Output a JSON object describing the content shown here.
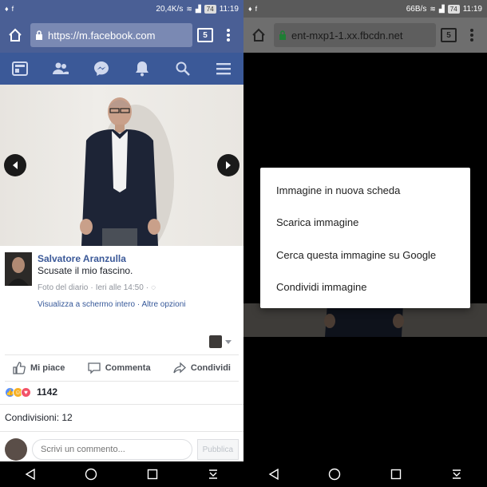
{
  "left": {
    "status": {
      "speed": "20,4K/s",
      "battery": "74",
      "time": "11:19"
    },
    "browser": {
      "url": "https://m.facebook.com",
      "tab_count": "5"
    },
    "post": {
      "author": "Salvatore Aranzulla",
      "caption": "Scusate il mio fascino.",
      "album": "Foto del diario",
      "separator": "·",
      "time": "Ieri alle 14:50",
      "view_fullscreen": "Visualizza a schermo intero",
      "more_options": "Altre opzioni",
      "actions": {
        "like": "Mi piace",
        "comment": "Commenta",
        "share": "Condividi"
      },
      "reaction_count": "1142",
      "shares": "Condivisioni: 12",
      "comment_placeholder": "Scrivi un commento...",
      "publish": "Pubblica"
    }
  },
  "right": {
    "status": {
      "speed": "66B/s",
      "battery": "74",
      "time": "11:19"
    },
    "browser": {
      "url": "ent-mxp1-1.xx.fbcdn.net",
      "tab_count": "5"
    },
    "context_menu": [
      "Immagine in nuova scheda",
      "Scarica immagine",
      "Cerca questa immagine su Google",
      "Condividi immagine"
    ]
  },
  "colors": {
    "facebook_blue": "#3b5998",
    "browser_bar": "#4a5f95",
    "link_blue": "#365899"
  },
  "icons": [
    "home-icon",
    "lock-icon",
    "tabs-icon",
    "overflow-menu-icon",
    "news-feed-icon",
    "friends-icon",
    "messenger-icon",
    "notifications-icon",
    "search-icon",
    "hamburger-menu-icon",
    "chevron-left-icon",
    "chevron-right-icon",
    "like-icon",
    "comment-icon",
    "share-icon",
    "back-icon",
    "home-circle-icon",
    "recents-icon",
    "notification-shade-icon"
  ]
}
